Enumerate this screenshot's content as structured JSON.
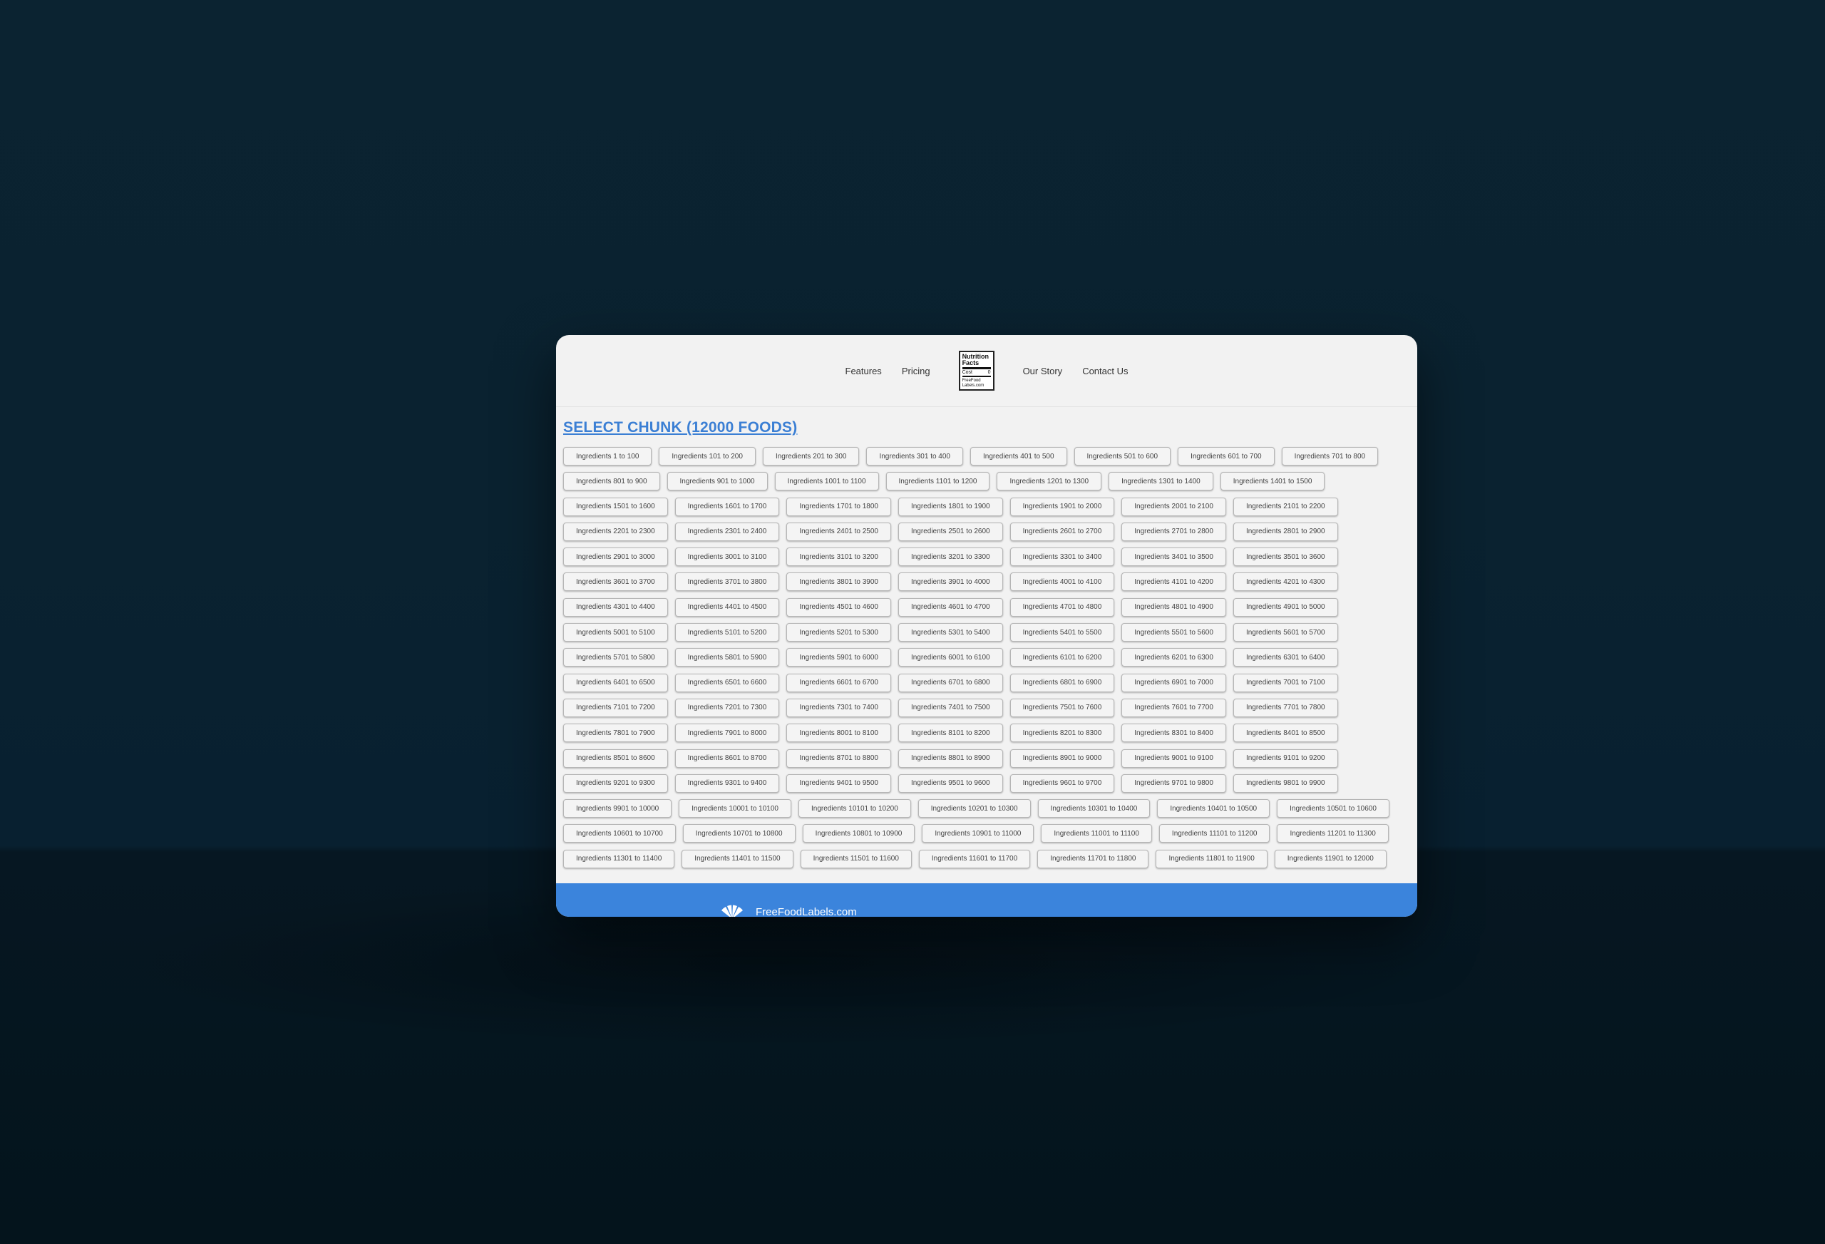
{
  "nav": {
    "features": "Features",
    "pricing": "Pricing",
    "our_story": "Our Story",
    "contact": "Contact Us",
    "logo": {
      "title": "Nutrition Facts",
      "row_label": "Cost",
      "row_value": "0",
      "footer": "FreeFood Labels.com"
    }
  },
  "heading": "SELECT CHUNK (12000 FOODS)",
  "rows": [
    [
      "Ingredients 1 to 100",
      "Ingredients 101 to 200",
      "Ingredients 201 to 300",
      "Ingredients 301 to 400",
      "Ingredients 401 to 500",
      "Ingredients 501 to 600",
      "Ingredients 601 to 700",
      "Ingredients 701 to 800"
    ],
    [
      "Ingredients 801 to 900",
      "Ingredients 901 to 1000",
      "Ingredients 1001 to 1100",
      "Ingredients 1101 to 1200",
      "Ingredients 1201 to 1300",
      "Ingredients 1301 to 1400",
      "Ingredients 1401 to 1500"
    ],
    [
      "Ingredients 1501 to 1600",
      "Ingredients 1601 to 1700",
      "Ingredients 1701 to 1800",
      "Ingredients 1801 to 1900",
      "Ingredients 1901 to 2000",
      "Ingredients 2001 to 2100",
      "Ingredients 2101 to 2200"
    ],
    [
      "Ingredients 2201 to 2300",
      "Ingredients 2301 to 2400",
      "Ingredients 2401 to 2500",
      "Ingredients 2501 to 2600",
      "Ingredients 2601 to 2700",
      "Ingredients 2701 to 2800",
      "Ingredients 2801 to 2900"
    ],
    [
      "Ingredients 2901 to 3000",
      "Ingredients 3001 to 3100",
      "Ingredients 3101 to 3200",
      "Ingredients 3201 to 3300",
      "Ingredients 3301 to 3400",
      "Ingredients 3401 to 3500",
      "Ingredients 3501 to 3600"
    ],
    [
      "Ingredients 3601 to 3700",
      "Ingredients 3701 to 3800",
      "Ingredients 3801 to 3900",
      "Ingredients 3901 to 4000",
      "Ingredients 4001 to 4100",
      "Ingredients 4101 to 4200",
      "Ingredients 4201 to 4300"
    ],
    [
      "Ingredients 4301 to 4400",
      "Ingredients 4401 to 4500",
      "Ingredients 4501 to 4600",
      "Ingredients 4601 to 4700",
      "Ingredients 4701 to 4800",
      "Ingredients 4801 to 4900",
      "Ingredients 4901 to 5000"
    ],
    [
      "Ingredients 5001 to 5100",
      "Ingredients 5101 to 5200",
      "Ingredients 5201 to 5300",
      "Ingredients 5301 to 5400",
      "Ingredients 5401 to 5500",
      "Ingredients 5501 to 5600",
      "Ingredients 5601 to 5700"
    ],
    [
      "Ingredients 5701 to 5800",
      "Ingredients 5801 to 5900",
      "Ingredients 5901 to 6000",
      "Ingredients 6001 to 6100",
      "Ingredients 6101 to 6200",
      "Ingredients 6201 to 6300",
      "Ingredients 6301 to 6400"
    ],
    [
      "Ingredients 6401 to 6500",
      "Ingredients 6501 to 6600",
      "Ingredients 6601 to 6700",
      "Ingredients 6701 to 6800",
      "Ingredients 6801 to 6900",
      "Ingredients 6901 to 7000",
      "Ingredients 7001 to 7100"
    ],
    [
      "Ingredients 7101 to 7200",
      "Ingredients 7201 to 7300",
      "Ingredients 7301 to 7400",
      "Ingredients 7401 to 7500",
      "Ingredients 7501 to 7600",
      "Ingredients 7601 to 7700",
      "Ingredients 7701 to 7800"
    ],
    [
      "Ingredients 7801 to 7900",
      "Ingredients 7901 to 8000",
      "Ingredients 8001 to 8100",
      "Ingredients 8101 to 8200",
      "Ingredients 8201 to 8300",
      "Ingredients 8301 to 8400",
      "Ingredients 8401 to 8500"
    ],
    [
      "Ingredients 8501 to 8600",
      "Ingredients 8601 to 8700",
      "Ingredients 8701 to 8800",
      "Ingredients 8801 to 8900",
      "Ingredients 8901 to 9000",
      "Ingredients 9001 to 9100",
      "Ingredients 9101 to 9200"
    ],
    [
      "Ingredients 9201 to 9300",
      "Ingredients 9301 to 9400",
      "Ingredients 9401 to 9500",
      "Ingredients 9501 to 9600",
      "Ingredients 9601 to 9700",
      "Ingredients 9701 to 9800",
      "Ingredients 9801 to 9900"
    ],
    [
      "Ingredients 9901 to 10000",
      "Ingredients 10001 to 10100",
      "Ingredients 10101 to 10200",
      "Ingredients 10201 to 10300",
      "Ingredients 10301 to 10400",
      "Ingredients 10401 to 10500",
      "Ingredients 10501 to 10600"
    ],
    [
      "Ingredients 10601 to 10700",
      "Ingredients 10701 to 10800",
      "Ingredients 10801 to 10900",
      "Ingredients 10901 to 11000",
      "Ingredients 11001 to 11100",
      "Ingredients 11101 to 11200",
      "Ingredients 11201 to 11300"
    ],
    [
      "Ingredients 11301 to 11400",
      "Ingredients 11401 to 11500",
      "Ingredients 11501 to 11600",
      "Ingredients 11601 to 11700",
      "Ingredients 11701 to 11800",
      "Ingredients 11801 to 11900",
      "Ingredients 11901 to 12000"
    ]
  ],
  "footer": {
    "brand": "FreeFoodLabels.com",
    "icon": "fan-logo-icon"
  },
  "colors": {
    "accent": "#3b7fd4",
    "footer_bg": "#3b84dc",
    "backdrop": "#0b2331"
  }
}
